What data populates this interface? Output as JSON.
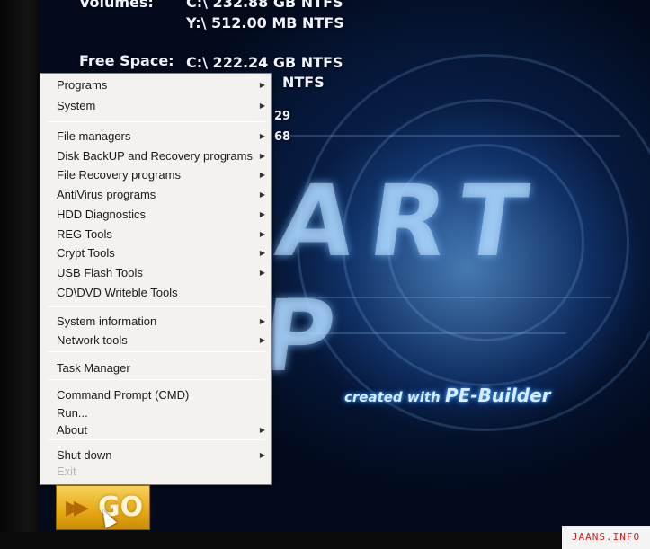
{
  "system_info": {
    "volumes_label": "Volumes:",
    "volumes": [
      "C:\\ 232.88 GB NTFS",
      "Y:\\ 512.00 MB NTFS"
    ],
    "free_space_label": "Free Space:",
    "free_space": [
      "C:\\ 222.24 GB NTFS",
      "NTFS"
    ],
    "partial_values": [
      "29",
      "68"
    ]
  },
  "desktop": {
    "created_with": "created with",
    "pe_builder": "PE-Builder"
  },
  "menu": {
    "groups": [
      [
        {
          "label": "Programs",
          "submenu": true
        },
        {
          "label": "System",
          "submenu": true
        }
      ],
      [
        {
          "label": "File managers",
          "submenu": true
        },
        {
          "label": "Disk BackUP and Recovery programs",
          "submenu": true
        },
        {
          "label": "File Recovery programs",
          "submenu": true
        },
        {
          "label": "AntiVirus programs",
          "submenu": true
        },
        {
          "label": "HDD Diagnostics",
          "submenu": true
        },
        {
          "label": "REG Tools",
          "submenu": true
        },
        {
          "label": "Crypt Tools",
          "submenu": true
        },
        {
          "label": "USB Flash Tools",
          "submenu": true
        },
        {
          "label": "CD\\DVD Writeble Tools",
          "submenu": false
        }
      ],
      [
        {
          "label": "System information",
          "submenu": true
        },
        {
          "label": "Network tools",
          "submenu": true
        }
      ],
      [
        {
          "label": "Task Manager",
          "submenu": false
        }
      ],
      [
        {
          "label": "Command Prompt (CMD)",
          "submenu": false
        },
        {
          "label": "Run...",
          "submenu": false
        },
        {
          "label": "About",
          "submenu": true
        }
      ],
      [
        {
          "label": "Shut down",
          "submenu": true
        },
        {
          "label": "Exit",
          "submenu": false,
          "disabled": true
        }
      ]
    ]
  },
  "go_button": {
    "label": "GO",
    "icon": "double-arrow-icon"
  },
  "watermark": "JAANS.INFO",
  "colors": {
    "menu_bg": "#f3f2ee",
    "go_button": "#e6a814",
    "desktop_glow": "#4aa0ff"
  }
}
